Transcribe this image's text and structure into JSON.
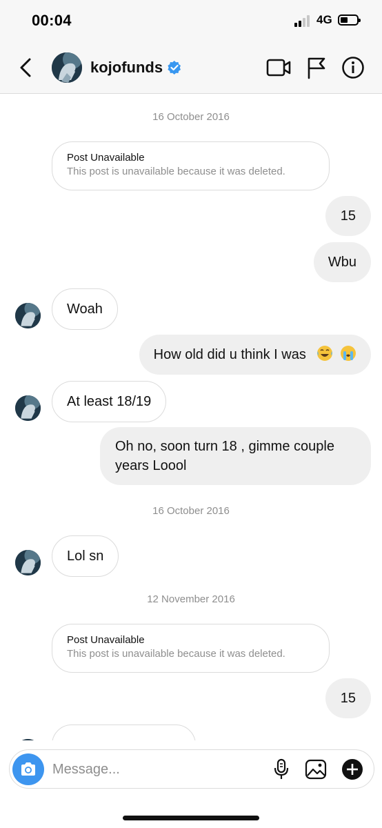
{
  "status_bar": {
    "time": "00:04",
    "network": "4G"
  },
  "header": {
    "username": "kojofunds"
  },
  "icons": {
    "back": "chevron-left-icon",
    "verified": "verified-badge-icon",
    "video": "video-camera-icon",
    "flag": "flag-icon",
    "info": "info-icon",
    "camera": "camera-icon",
    "mic": "microphone-icon",
    "gallery": "image-icon",
    "add": "plus-circle-icon"
  },
  "colors": {
    "accent": "#3d95ef",
    "verified": "#3897f0",
    "incoming_border": "#dbdbdb",
    "outgoing_bg": "#efefef",
    "meta_text": "#8e8e8e"
  },
  "messages": {
    "date_1": "16 October 2016",
    "post_1": {
      "title": "Post Unavailable",
      "body": "This post is unavailable because it was deleted."
    },
    "out_1": "15",
    "out_2": "Wbu",
    "in_1": "Woah",
    "out_3": "How old did u think I was",
    "out_3_emojis": [
      "face-with-tears-of-joy",
      "loudly-crying-face"
    ],
    "in_2": "At least 18/19",
    "out_4": "Oh no, soon turn 18 , gimme couple years Loool",
    "date_2": "16 October 2016",
    "in_3": "Lol sn",
    "date_3": "12 November 2016",
    "post_2": {
      "title": "Post Unavailable",
      "body": "This post is unavailable because it was deleted."
    },
    "out_5": "15"
  },
  "composer": {
    "placeholder": "Message..."
  }
}
